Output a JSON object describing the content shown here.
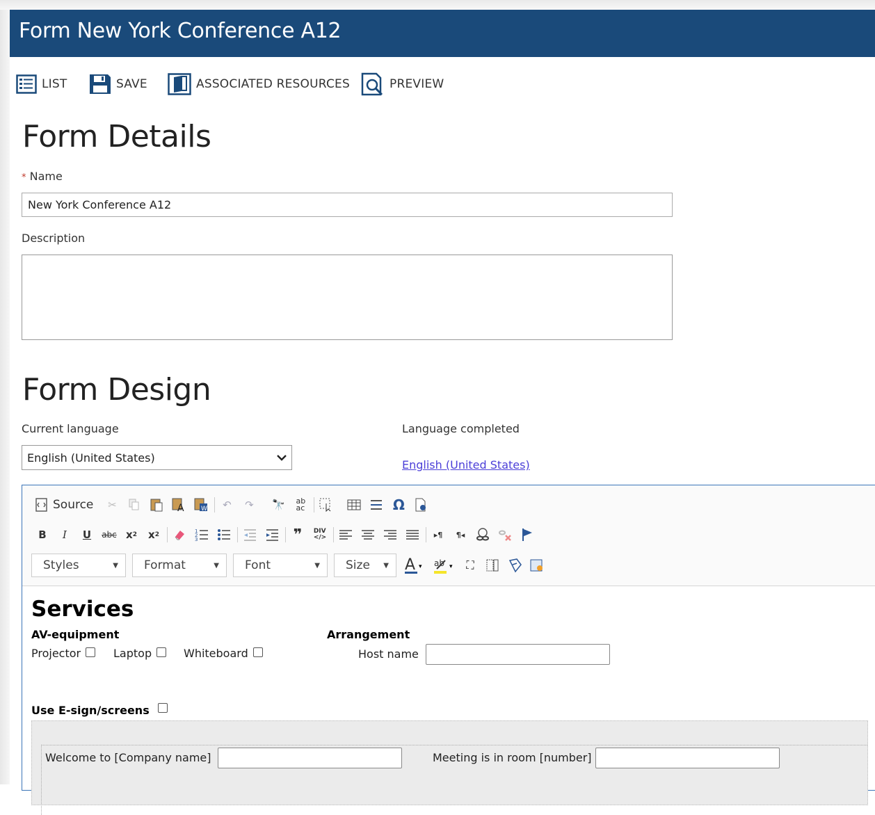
{
  "window": {
    "title": "Form New York Conference A12"
  },
  "toolbar": {
    "list": "LIST",
    "save": "SAVE",
    "associated_resources": "ASSOCIATED RESOURCES",
    "preview": "PREVIEW"
  },
  "form_details": {
    "heading": "Form Details",
    "name_label": "Name",
    "required_marker": "*",
    "name_value": "New York Conference A12",
    "description_label": "Description",
    "description_value": ""
  },
  "form_design": {
    "heading": "Form Design",
    "current_language_label": "Current language",
    "current_language_value": "English (United States)",
    "language_completed_label": "Language completed",
    "language_completed_link": "English (United States)"
  },
  "editor": {
    "source_label": "Source",
    "combos": [
      "Styles",
      "Format",
      "Font",
      "Size"
    ]
  },
  "content": {
    "title": "Services",
    "av_heading": "AV-equipment",
    "av_items": [
      "Projector",
      "Laptop",
      "Whiteboard"
    ],
    "arrangement_heading": "Arrangement",
    "host_label": "Host name",
    "esign_label": "Use E-sign/screens",
    "welcome_label": "Welcome to [Company name]",
    "meeting_label": "Meeting is in room [number]"
  }
}
